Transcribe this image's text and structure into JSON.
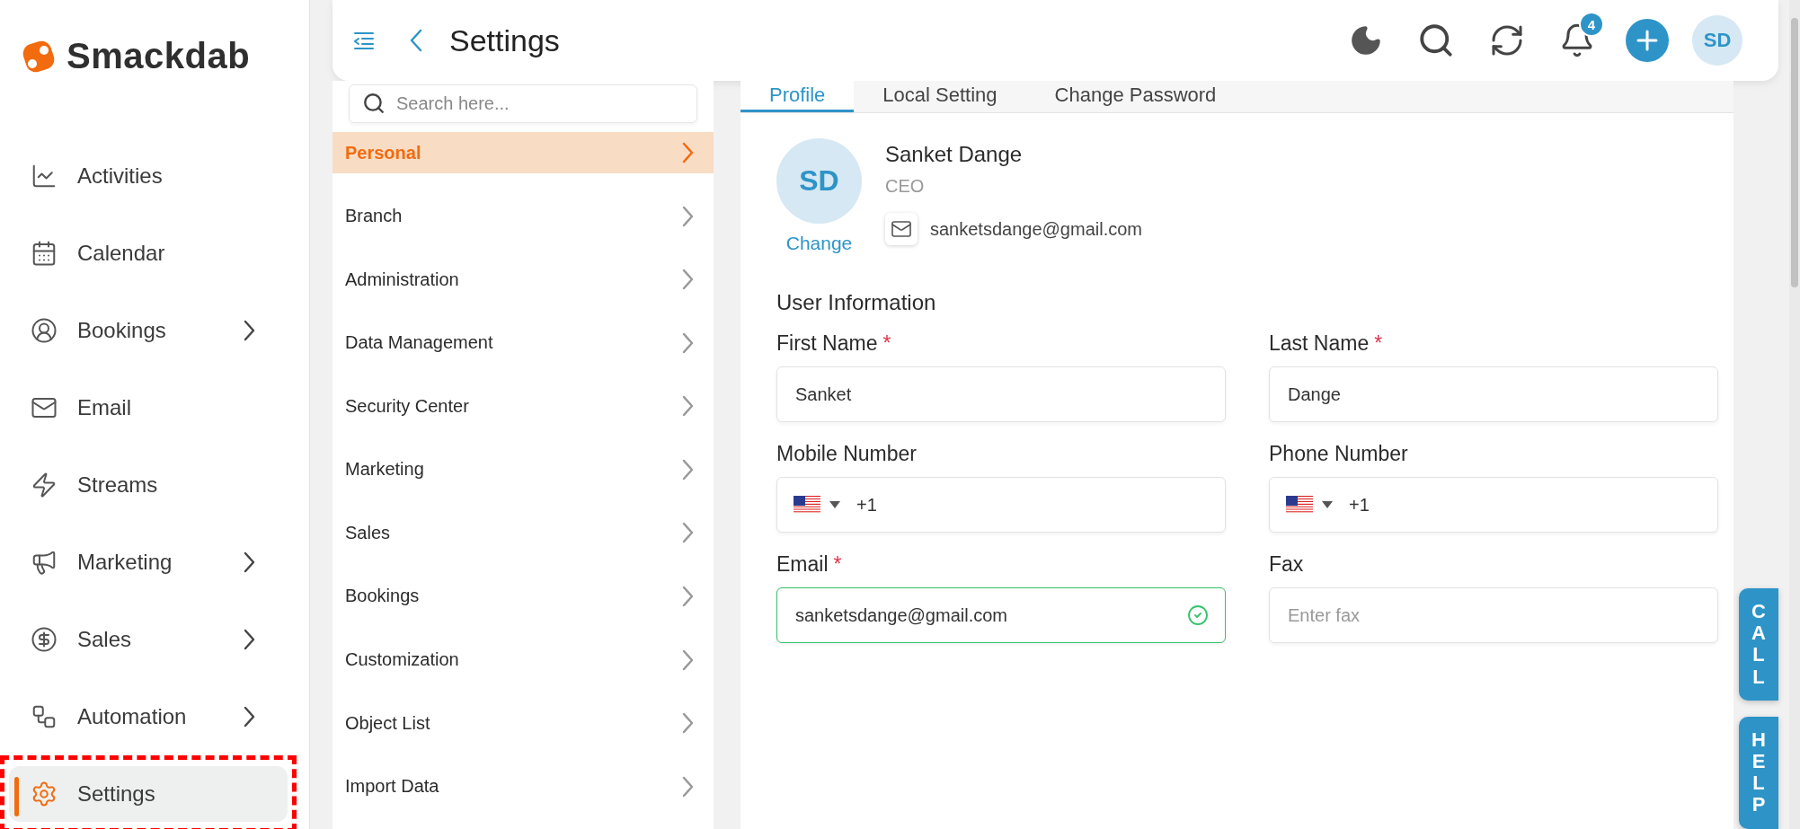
{
  "brand": {
    "name": "Smackdab"
  },
  "nav": [
    {
      "label": "Activities",
      "kind": "chart",
      "expandable": false,
      "selected": false
    },
    {
      "label": "Calendar",
      "kind": "calendar",
      "expandable": false,
      "selected": false
    },
    {
      "label": "Bookings",
      "kind": "user",
      "expandable": true,
      "selected": false
    },
    {
      "label": "Email",
      "kind": "mail",
      "expandable": false,
      "selected": false
    },
    {
      "label": "Streams",
      "kind": "bolt",
      "expandable": false,
      "selected": false
    },
    {
      "label": "Marketing",
      "kind": "megaphone",
      "expandable": true,
      "selected": false
    },
    {
      "label": "Sales",
      "kind": "dollar",
      "expandable": true,
      "selected": false
    },
    {
      "label": "Automation",
      "kind": "flow",
      "expandable": true,
      "selected": false
    },
    {
      "label": "Settings",
      "kind": "gear",
      "expandable": false,
      "selected": true
    }
  ],
  "header": {
    "title": "Settings",
    "notifications": "4",
    "avatar": "SD"
  },
  "settings_menu": {
    "search": {
      "placeholder": "Search here..."
    },
    "items": [
      {
        "label": "Personal",
        "selected": true
      },
      {
        "label": "Branch",
        "selected": false
      },
      {
        "label": "Administration",
        "selected": false
      },
      {
        "label": "Data Management",
        "selected": false
      },
      {
        "label": "Security Center",
        "selected": false
      },
      {
        "label": "Marketing",
        "selected": false
      },
      {
        "label": "Sales",
        "selected": false
      },
      {
        "label": "Bookings",
        "selected": false
      },
      {
        "label": "Customization",
        "selected": false
      },
      {
        "label": "Object List",
        "selected": false
      },
      {
        "label": "Import Data",
        "selected": false
      }
    ]
  },
  "tabs": [
    {
      "label": "Profile",
      "selected": true
    },
    {
      "label": "Local Setting",
      "selected": false
    },
    {
      "label": "Change Password",
      "selected": false
    }
  ],
  "profile": {
    "initials": "SD",
    "change": "Change",
    "name": "Sanket Dange",
    "role": "CEO",
    "email": "sanketsdange@gmail.com"
  },
  "section_title": "User Information",
  "fields": [
    {
      "label": "First Name",
      "mark": "*",
      "kind": "text",
      "value": "Sanket",
      "valid": false
    },
    {
      "label": "Last Name",
      "mark": "*",
      "kind": "text",
      "value": "Dange",
      "valid": false
    },
    {
      "label": "Mobile Number",
      "kind": "phone",
      "value": "+1",
      "valid": false
    },
    {
      "label": "Phone Number",
      "kind": "phone",
      "value": "+1",
      "valid": false
    },
    {
      "label": "Email",
      "mark": "*",
      "kind": "text",
      "value": "sanketsdange@gmail.com",
      "valid": true
    },
    {
      "label": "Fax",
      "kind": "text",
      "placeholder": "Enter fax",
      "valid": false
    }
  ],
  "side_tabs": [
    "CALL",
    "HELP"
  ]
}
